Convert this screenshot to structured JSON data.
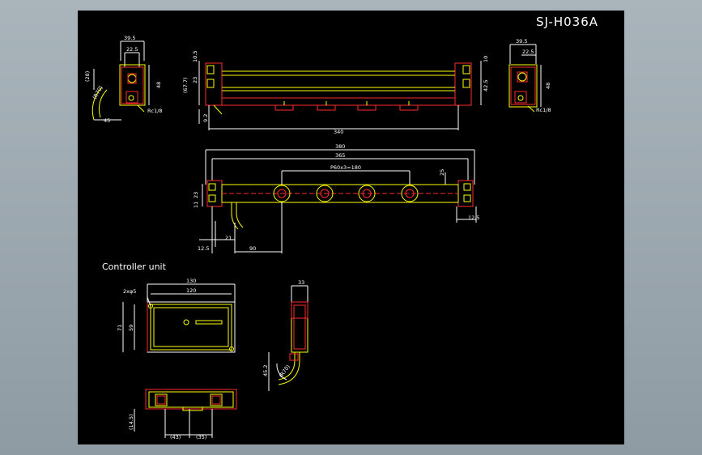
{
  "title": "SJ-H036A",
  "section_label": "Controller unit",
  "colors": {
    "background": "#000000",
    "frame": "#98a4ac",
    "outline": "#ffff00",
    "body": "#ff2a2a",
    "dimension": "#ffffff"
  },
  "dims": {
    "left_top": "39.5",
    "left_mid": "22.5",
    "left_side": "(28)",
    "left_height": "48",
    "left_angle": "(R70)",
    "left_bottom": "45",
    "left_thread": "Rc1/8",
    "front_h1": "10.5",
    "front_h2": "23",
    "front_h3": "(67.7)",
    "front_h4": "9.2",
    "front_len": "340",
    "front_r1": "10",
    "front_r2": "42.5",
    "right_top": "39.5",
    "right_mid": "22.5",
    "right_height": "48",
    "right_thread": "Rc1/8",
    "top_total": "380",
    "top_inner": "365",
    "pitch": "P60x3=180",
    "top_side": "25",
    "top_left": "23",
    "top_left2": "11",
    "top_right": "12.5",
    "top_b1": "12.5",
    "top_b2": "21",
    "top_b3": "90",
    "ctrl_w1": "130",
    "ctrl_w2": "120",
    "ctrl_hole": "2xφ5",
    "ctrl_h1": "71",
    "ctrl_h2": "59",
    "ctrl_side_w": "33",
    "ctrl_side_h": "45.2",
    "ctrl_side_r": "(R70)",
    "ctrl_bot_h": "(14.5)",
    "ctrl_bot_w1": "(43)",
    "ctrl_bot_w2": "(35)"
  }
}
